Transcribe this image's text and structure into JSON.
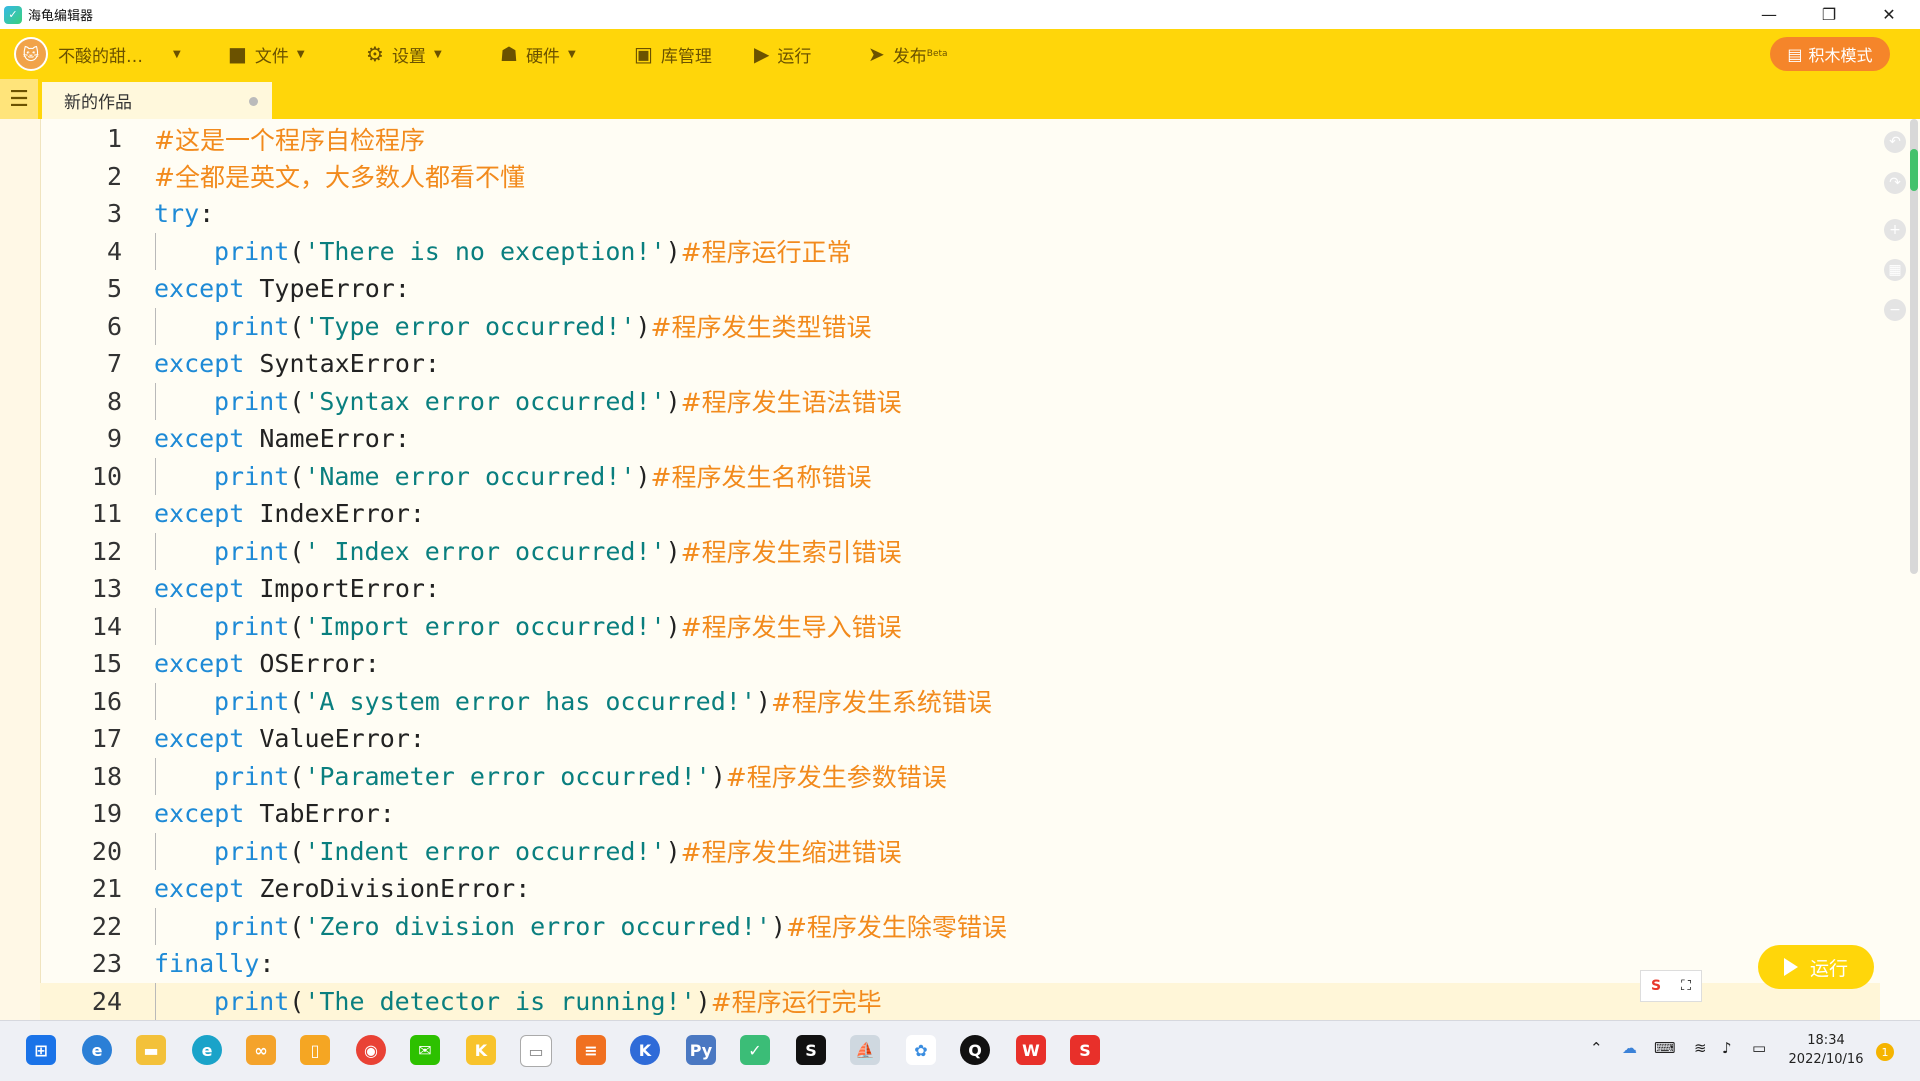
{
  "window": {
    "title": "海龟编辑器"
  },
  "toolbar": {
    "user": "不酸的甜…",
    "file": "文件",
    "settings": "设置",
    "hardware": "硬件",
    "library": "库管理",
    "run": "运行",
    "publish": "发布",
    "publish_badge": "Beta",
    "block_mode": "积木模式"
  },
  "tabs": [
    {
      "label": "新的作品"
    }
  ],
  "code_lines": [
    {
      "n": "1",
      "comment": "#这是一个程序自检程序"
    },
    {
      "n": "2",
      "comment": "#全都是英文，大多数人都看不懂"
    },
    {
      "n": "3",
      "kw": "try",
      "rest": ":"
    },
    {
      "n": "4",
      "fn": "print",
      "str": "'There is no exception!'",
      "comment": "#程序运行正常"
    },
    {
      "n": "5",
      "kw": "except",
      "rest": " TypeError:"
    },
    {
      "n": "6",
      "fn": "print",
      "str": "'Type error occurred!'",
      "comment": "#程序发生类型错误"
    },
    {
      "n": "7",
      "kw": "except",
      "rest": " SyntaxError:"
    },
    {
      "n": "8",
      "fn": "print",
      "str": "'Syntax error occurred!'",
      "comment": "#程序发生语法错误"
    },
    {
      "n": "9",
      "kw": "except",
      "rest": " NameError:"
    },
    {
      "n": "10",
      "fn": "print",
      "str": "'Name error occurred!'",
      "comment": "#程序发生名称错误"
    },
    {
      "n": "11",
      "kw": "except",
      "rest": " IndexError:"
    },
    {
      "n": "12",
      "fn": "print",
      "str": "' Index error occurred!'",
      "comment": "#程序发生索引错误"
    },
    {
      "n": "13",
      "kw": "except",
      "rest": " ImportError:"
    },
    {
      "n": "14",
      "fn": "print",
      "str": "'Import error occurred!'",
      "comment": "#程序发生导入错误"
    },
    {
      "n": "15",
      "kw": "except",
      "rest": " OSError:"
    },
    {
      "n": "16",
      "fn": "print",
      "str": "'A system error has occurred!'",
      "comment": "#程序发生系统错误"
    },
    {
      "n": "17",
      "kw": "except",
      "rest": " ValueError:"
    },
    {
      "n": "18",
      "fn": "print",
      "str": "'Parameter error occurred!'",
      "comment": "#程序发生参数错误"
    },
    {
      "n": "19",
      "kw": "except",
      "rest": " TabError:"
    },
    {
      "n": "20",
      "fn": "print",
      "str": "'Indent error occurred!'",
      "comment": "#程序发生缩进错误"
    },
    {
      "n": "21",
      "kw": "except",
      "rest": " ZeroDivisionError:"
    },
    {
      "n": "22",
      "fn": "print",
      "str": "'Zero division error occurred!'",
      "comment": "#程序发生除零错误"
    },
    {
      "n": "23",
      "kw": "finally",
      "rest": ":"
    },
    {
      "n": "24",
      "fn": "print",
      "str": "'The detector is running!'",
      "comment": "#程序运行完毕"
    }
  ],
  "run_button": "运行",
  "taskbar": {
    "time": "18:34",
    "date": "2022/10/16",
    "notifications": "1"
  },
  "colors": {
    "toolbar": "#ffd60a",
    "keyword": "#1e8ad6",
    "string": "#0a7f7f",
    "comment": "#f28a1c",
    "block_mode": "#f5852a"
  }
}
